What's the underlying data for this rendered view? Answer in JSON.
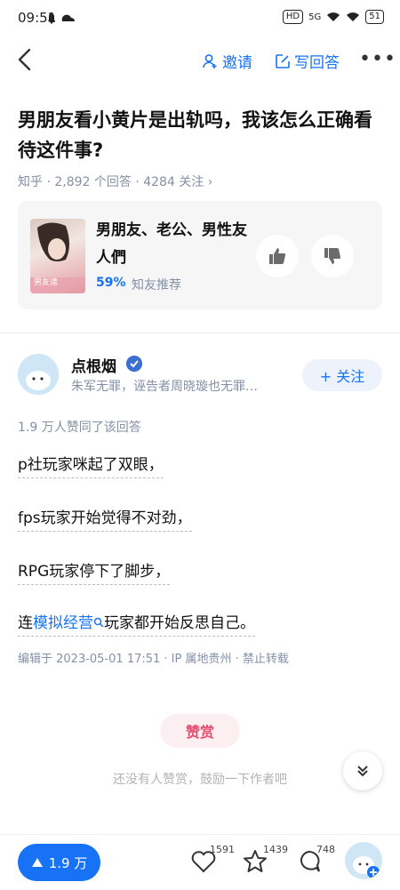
{
  "status": {
    "time": "09:51",
    "network": "HD",
    "signal": "5G",
    "battery": "51"
  },
  "nav": {
    "invite_label": "邀请",
    "write_label": "写回答",
    "more": "•••"
  },
  "question": {
    "title": "男朋友看小黄片是出轨吗，我该怎么正确看待这件事?",
    "meta": "知乎 · 2,892 个回答 · 4284 关注 ›"
  },
  "card": {
    "title": "男朋友、老公、男性友人們",
    "percent": "59%",
    "recommend": "知友推荐",
    "image_text": "男友達"
  },
  "author": {
    "name": "点根烟",
    "bio": "朱军无罪，诬告者周晓璇也无罪…",
    "follow_label": "+ 关注"
  },
  "answer": {
    "likes_note": "1.9 万人赞同了该回答",
    "p1": "p社玩家咪起了双眼，",
    "p2": "fps玩家开始觉得不对劲，",
    "p3": "RPG玩家停下了脚步，",
    "p4_prefix": "连",
    "p4_link": "模拟经营",
    "p4_suffix": "玩家都开始反思自己。",
    "edit_meta": "编辑于 2023-05-01 17:51 · IP 属地贵州 · 禁止转载"
  },
  "reward": {
    "label": "赞赏",
    "hint": "还没有人赞赏，鼓励一下作者吧"
  },
  "bottom": {
    "upvote_label": "1.9 万",
    "like_count": "1591",
    "star_count": "1439",
    "comment_count": "748"
  },
  "colors": {
    "accent": "#1772f6",
    "reward": "#e44b6e",
    "muted": "#8590a6"
  },
  "icons": [
    "back-arrow-icon",
    "add-user-icon",
    "edit-icon",
    "more-icon",
    "thumb-up-icon",
    "thumb-down-icon",
    "verified-badge-icon",
    "search-icon",
    "chevron-double-down-icon",
    "triangle-up-icon",
    "heart-icon",
    "star-icon",
    "comment-icon"
  ]
}
